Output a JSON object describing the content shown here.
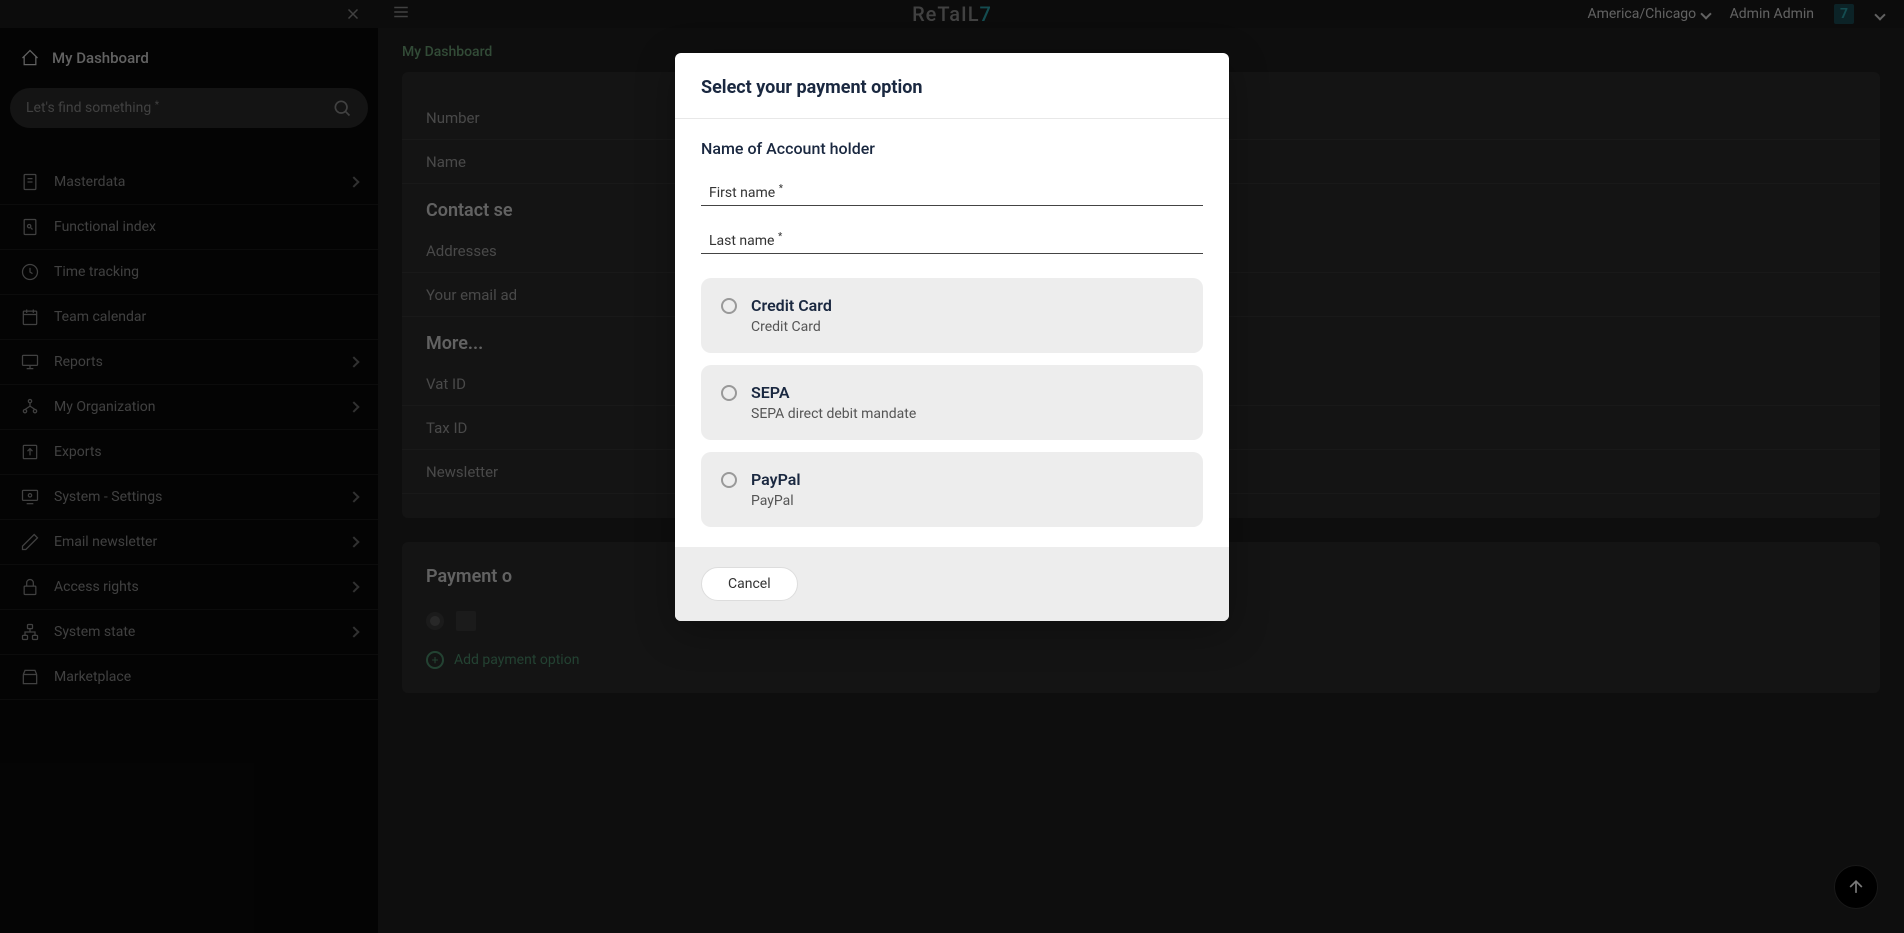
{
  "topbar": {
    "brand_prefix": "ReTaIL",
    "brand_suffix": "7",
    "timezone": "America/Chicago",
    "username": "Admin Admin"
  },
  "sidebar": {
    "title": "My Dashboard",
    "search_placeholder": "Let's find something",
    "items": [
      {
        "label": "Masterdata",
        "icon": "document",
        "expandable": true
      },
      {
        "label": "Functional index",
        "icon": "document-search",
        "expandable": false
      },
      {
        "label": "Time tracking",
        "icon": "clock",
        "expandable": false
      },
      {
        "label": "Team calendar",
        "icon": "calendar",
        "expandable": false
      },
      {
        "label": "Reports",
        "icon": "monitor",
        "expandable": true
      },
      {
        "label": "My Organization",
        "icon": "org",
        "expandable": true
      },
      {
        "label": "Exports",
        "icon": "export",
        "expandable": false
      },
      {
        "label": "System - Settings",
        "icon": "settings-monitor",
        "expandable": true
      },
      {
        "label": "Email newsletter",
        "icon": "pen",
        "expandable": true
      },
      {
        "label": "Access rights",
        "icon": "lock",
        "expandable": true
      },
      {
        "label": "System state",
        "icon": "network",
        "expandable": true
      },
      {
        "label": "Marketplace",
        "icon": "store",
        "expandable": false
      }
    ]
  },
  "breadcrumb": "My Dashboard",
  "form": {
    "rows": [
      "Number",
      "Name"
    ],
    "contact_header": "Contact se",
    "contact_rows": [
      "Addresses",
      "Your email ad"
    ],
    "more_header": "More...",
    "more_rows": [
      "Vat ID",
      "Tax ID",
      "Newsletter"
    ]
  },
  "payment_section": {
    "header": "Payment o",
    "add_label": "Add payment option"
  },
  "modal": {
    "title": "Select your payment option",
    "account_holder_label": "Name of Account holder",
    "first_name_label": "First name",
    "last_name_label": "Last name",
    "options": [
      {
        "name": "Credit Card",
        "desc": "Credit Card"
      },
      {
        "name": "SEPA",
        "desc": "SEPA direct debit mandate"
      },
      {
        "name": "PayPal",
        "desc": "PayPal"
      }
    ],
    "cancel_label": "Cancel"
  }
}
